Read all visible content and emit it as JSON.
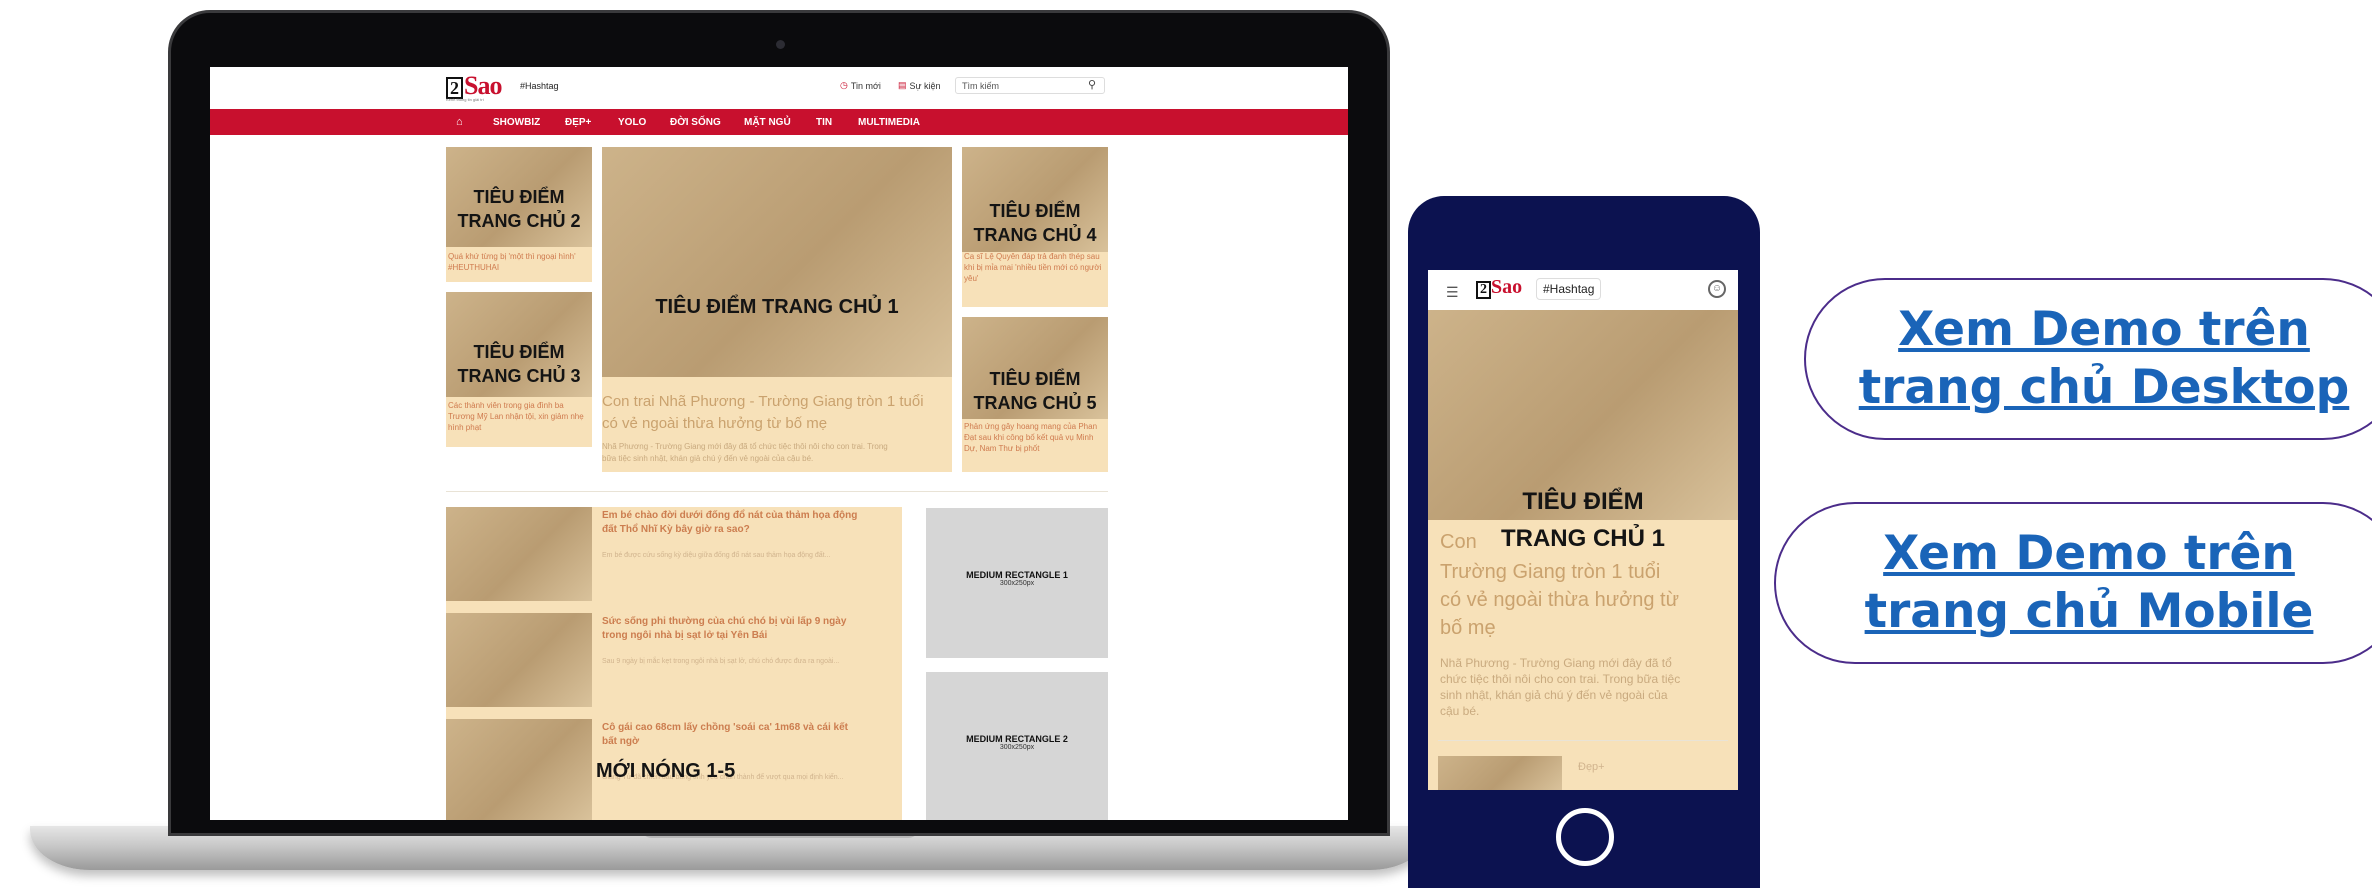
{
  "colors": {
    "brand_red": "#c8102e",
    "phone_navy": "#0c1250",
    "cta_border": "#4b2c8a",
    "cta_link": "#1a64b8"
  },
  "site": {
    "logo_num": "2",
    "logo_text": "Sao",
    "logo_tagline": "Kênh thông tin giải trí",
    "hashtag": "#Hashtag",
    "util_new": "Tin mới",
    "util_event": "Sự kiện",
    "search_placeholder": "Tìm kiếm",
    "nav": [
      "SHOWBIZ",
      "ĐẸP+",
      "YOLO",
      "ĐỜI SỐNG",
      "MẶT NGỦ",
      "TIN",
      "MULTIMEDIA"
    ]
  },
  "desktop": {
    "tile2": {
      "title_l1": "TIÊU ĐIỂM",
      "title_l2": "TRANG CHỦ 2",
      "caption": "Quá khứ từng bị 'một thì ngoại hình' #HEUTHUHAI"
    },
    "tile3": {
      "title_l1": "TIÊU ĐIỂM",
      "title_l2": "TRANG CHỦ 3",
      "caption": "Các thành viên trong gia đình ba Trương Mỹ Lan nhận tội, xin giảm nhẹ hình phạt"
    },
    "tile1": {
      "title": "TIÊU ĐIỂM TRANG CHỦ 1",
      "caption_l1": "Con trai Nhã Phương - Trường Giang tròn 1 tuổi",
      "caption_l2": "có vẻ ngoài thừa hưởng từ bố mẹ",
      "sub_l1": "Nhã Phương - Trường Giang mới đây đã tổ chức tiệc thôi nôi cho con trai. Trong",
      "sub_l2": "bữa tiệc sinh nhật, khán giả chú ý đến vẻ ngoài của cậu bé."
    },
    "tile4": {
      "title_l1": "TIÊU ĐIỂM",
      "title_l2": "TRANG CHỦ 4",
      "caption": "Ca sĩ Lệ Quyên đáp trả đanh thép sau khi bị mỉa mai 'nhiều tiền mới có người yêu'"
    },
    "tile5": {
      "title_l1": "TIÊU ĐIỂM",
      "title_l2": "TRANG CHỦ 5",
      "caption": "Phản ứng gây hoang mang của Phan Đạt sau khi công bố kết quả vụ Minh Dự, Nam Thư bị phốt"
    },
    "news": [
      {
        "title_l1": "Em bé chào đời dưới đống đổ nát của thảm họa động",
        "title_l2": "đất Thổ Nhĩ Kỳ bây giờ ra sao?",
        "meta": "Em bé được cứu sống kỳ diệu giữa đống đổ nát sau thảm họa động đất..."
      },
      {
        "title_l1": "Sức sống phi thường của chú chó bị vùi lấp 9 ngày",
        "title_l2": "trong ngôi nhà bị sạt lở tại Yên Bái",
        "meta": "Sau 9 ngày bị mắc kẹt trong ngôi nhà bị sạt lở, chú chó được đưa ra ngoài..."
      },
      {
        "title_l1": "Cô gái cao 68cm lấy chồng 'soái ca' 1m68 và cái kết",
        "title_l2": "bất ngờ",
        "meta": "Giang Tử đã chiến đấu bằng tình yêu chân thành để vượt qua mọi định kiến..."
      }
    ],
    "hot_label": "MỚI NÓNG 1-5",
    "rect1": {
      "label": "MEDIUM RECTANGLE 1",
      "size": "300x250px"
    },
    "rect2": {
      "label": "MEDIUM RECTANGLE 2",
      "size": "300x250px"
    }
  },
  "mobile": {
    "hashtag": "#Hashtag",
    "title_l1": "TIÊU ĐIỂM",
    "title_l2": "TRANG CHỦ 1",
    "caption_lead": "Con",
    "caption_l2": "Trường Giang tròn 1 tuổi",
    "caption_l3": "có vẻ ngoài thừa hưởng từ",
    "caption_l4": "bố mẹ",
    "sub_l1": "Nhã Phương - Trường Giang mới đây đã tổ",
    "sub_l2": "chức tiệc thôi nôi cho con trai. Trong bữa tiệc",
    "sub_l3": "sinh nhật, khán giả chú ý đến vẻ ngoài của",
    "sub_l4": "cậu bé.",
    "bottom_tag": "Đẹp+"
  },
  "cta": {
    "desktop_l1": "Xem Demo trên",
    "desktop_l2": "trang chủ Desktop",
    "mobile_l1": "Xem Demo trên",
    "mobile_l2": "trang chủ Mobile"
  }
}
